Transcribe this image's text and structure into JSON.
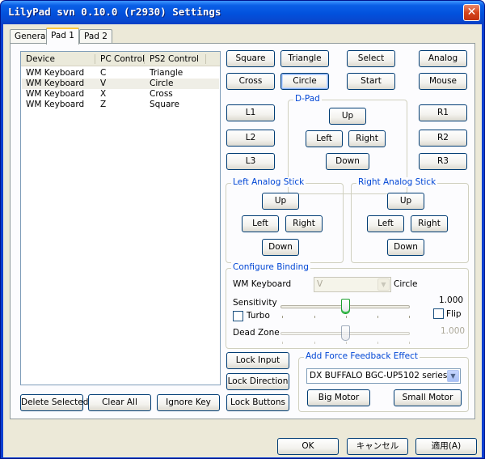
{
  "window": {
    "title": "LilyPad svn 0.10.0 (r2930) Settings",
    "close_glyph": "✕"
  },
  "tabs": [
    "General",
    "Pad 1",
    "Pad 2"
  ],
  "list": {
    "columns": [
      "Device",
      "PC Control",
      "PS2 Control"
    ],
    "rows": [
      [
        "WM Keyboard",
        "C",
        "Triangle"
      ],
      [
        "WM Keyboard",
        "V",
        "Circle"
      ],
      [
        "WM Keyboard",
        "X",
        "Cross"
      ],
      [
        "WM Keyboard",
        "Z",
        "Square"
      ]
    ]
  },
  "list_buttons": {
    "delete": "Delete Selected",
    "clear": "Clear All",
    "ignore": "Ignore Key"
  },
  "face_buttons": {
    "square": "Square",
    "triangle": "Triangle",
    "select": "Select",
    "analog": "Analog",
    "cross": "Cross",
    "circle": "Circle",
    "start": "Start",
    "mouse": "Mouse"
  },
  "shoulders": {
    "l1": "L1",
    "l2": "L2",
    "l3": "L3",
    "r1": "R1",
    "r2": "R2",
    "r3": "R3"
  },
  "dpad": {
    "label": "D-Pad",
    "up": "Up",
    "left": "Left",
    "right": "Right",
    "down": "Down"
  },
  "left_stick": {
    "label": "Left Analog Stick",
    "up": "Up",
    "left": "Left",
    "right": "Right",
    "down": "Down"
  },
  "right_stick": {
    "label": "Right Analog Stick",
    "up": "Up",
    "left": "Left",
    "right": "Right",
    "down": "Down"
  },
  "binding": {
    "label": "Configure Binding",
    "device": "WM Keyboard",
    "key_value": "V",
    "control": "Circle",
    "sensitivity_label": "Sensitivity",
    "sensitivity_value": "1.000",
    "sensitivity_level": 0.5,
    "turbo_label": "Turbo",
    "flip_label": "Flip",
    "deadzone_label": "Dead Zone",
    "deadzone_value": "1.000",
    "deadzone_level": 0.5
  },
  "lock_buttons": {
    "input": "Lock Input",
    "direction": "Lock Direction",
    "buttons": "Lock Buttons"
  },
  "force_feedback": {
    "label": "Add Force Feedback Effect",
    "device": "DX BUFFALO BGC-UP5102 series",
    "big_motor": "Big Motor",
    "small_motor": "Small Motor"
  },
  "dialog": {
    "ok": "OK",
    "cancel": "キャンセル",
    "apply": "適用(A)"
  }
}
